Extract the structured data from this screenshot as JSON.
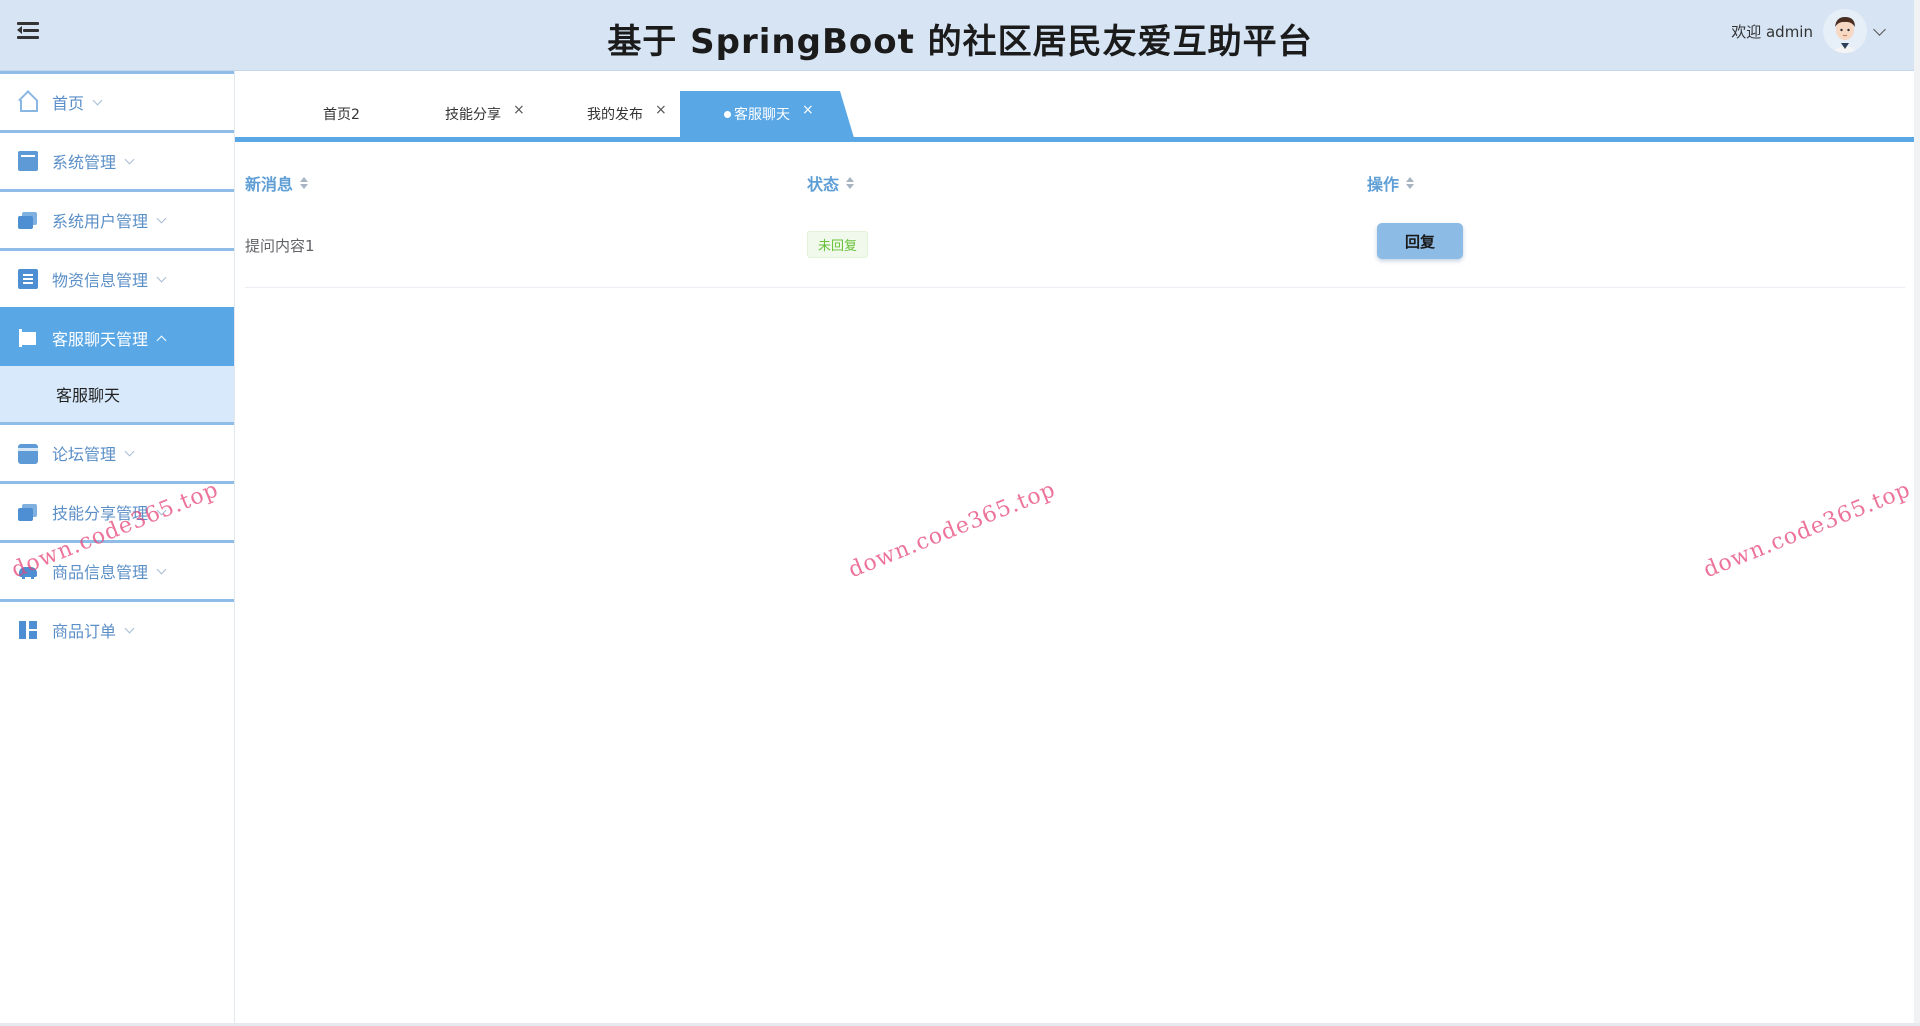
{
  "header": {
    "title": "基于 SpringBoot 的社区居民友爱互助平台",
    "welcome": "欢迎 admin"
  },
  "sidebar": {
    "items": [
      {
        "label": "首页",
        "icon": "home-icon"
      },
      {
        "label": "系统管理",
        "icon": "monitor-icon"
      },
      {
        "label": "系统用户管理",
        "icon": "users-icon"
      },
      {
        "label": "物资信息管理",
        "icon": "building-icon"
      },
      {
        "label": "客服聊天管理",
        "icon": "crop-icon",
        "active": true
      },
      {
        "label": "论坛管理",
        "icon": "card-icon"
      },
      {
        "label": "技能分享管理",
        "icon": "stack-icon"
      },
      {
        "label": "商品信息管理",
        "icon": "car-icon"
      },
      {
        "label": "商品订单",
        "icon": "dashboard-icon"
      }
    ],
    "submenu": {
      "label": "客服聊天"
    }
  },
  "tabs": [
    {
      "label": "首页2",
      "closable": false
    },
    {
      "label": "技能分享",
      "closable": true
    },
    {
      "label": "我的发布",
      "closable": true
    },
    {
      "label": "客服聊天",
      "closable": true,
      "active": true
    }
  ],
  "tab_close_glyph": "×",
  "table": {
    "columns": [
      "新消息",
      "状态",
      "操作"
    ],
    "rows": [
      {
        "message": "提问内容1",
        "status": "未回复",
        "action": "回复"
      }
    ]
  },
  "watermark": "down.code365.top",
  "colors": {
    "header_bg": "#d6e4f4",
    "accent": "#5aa7e6",
    "submenu_bg": "#d7e9fa",
    "status_green": "#67c23a"
  }
}
